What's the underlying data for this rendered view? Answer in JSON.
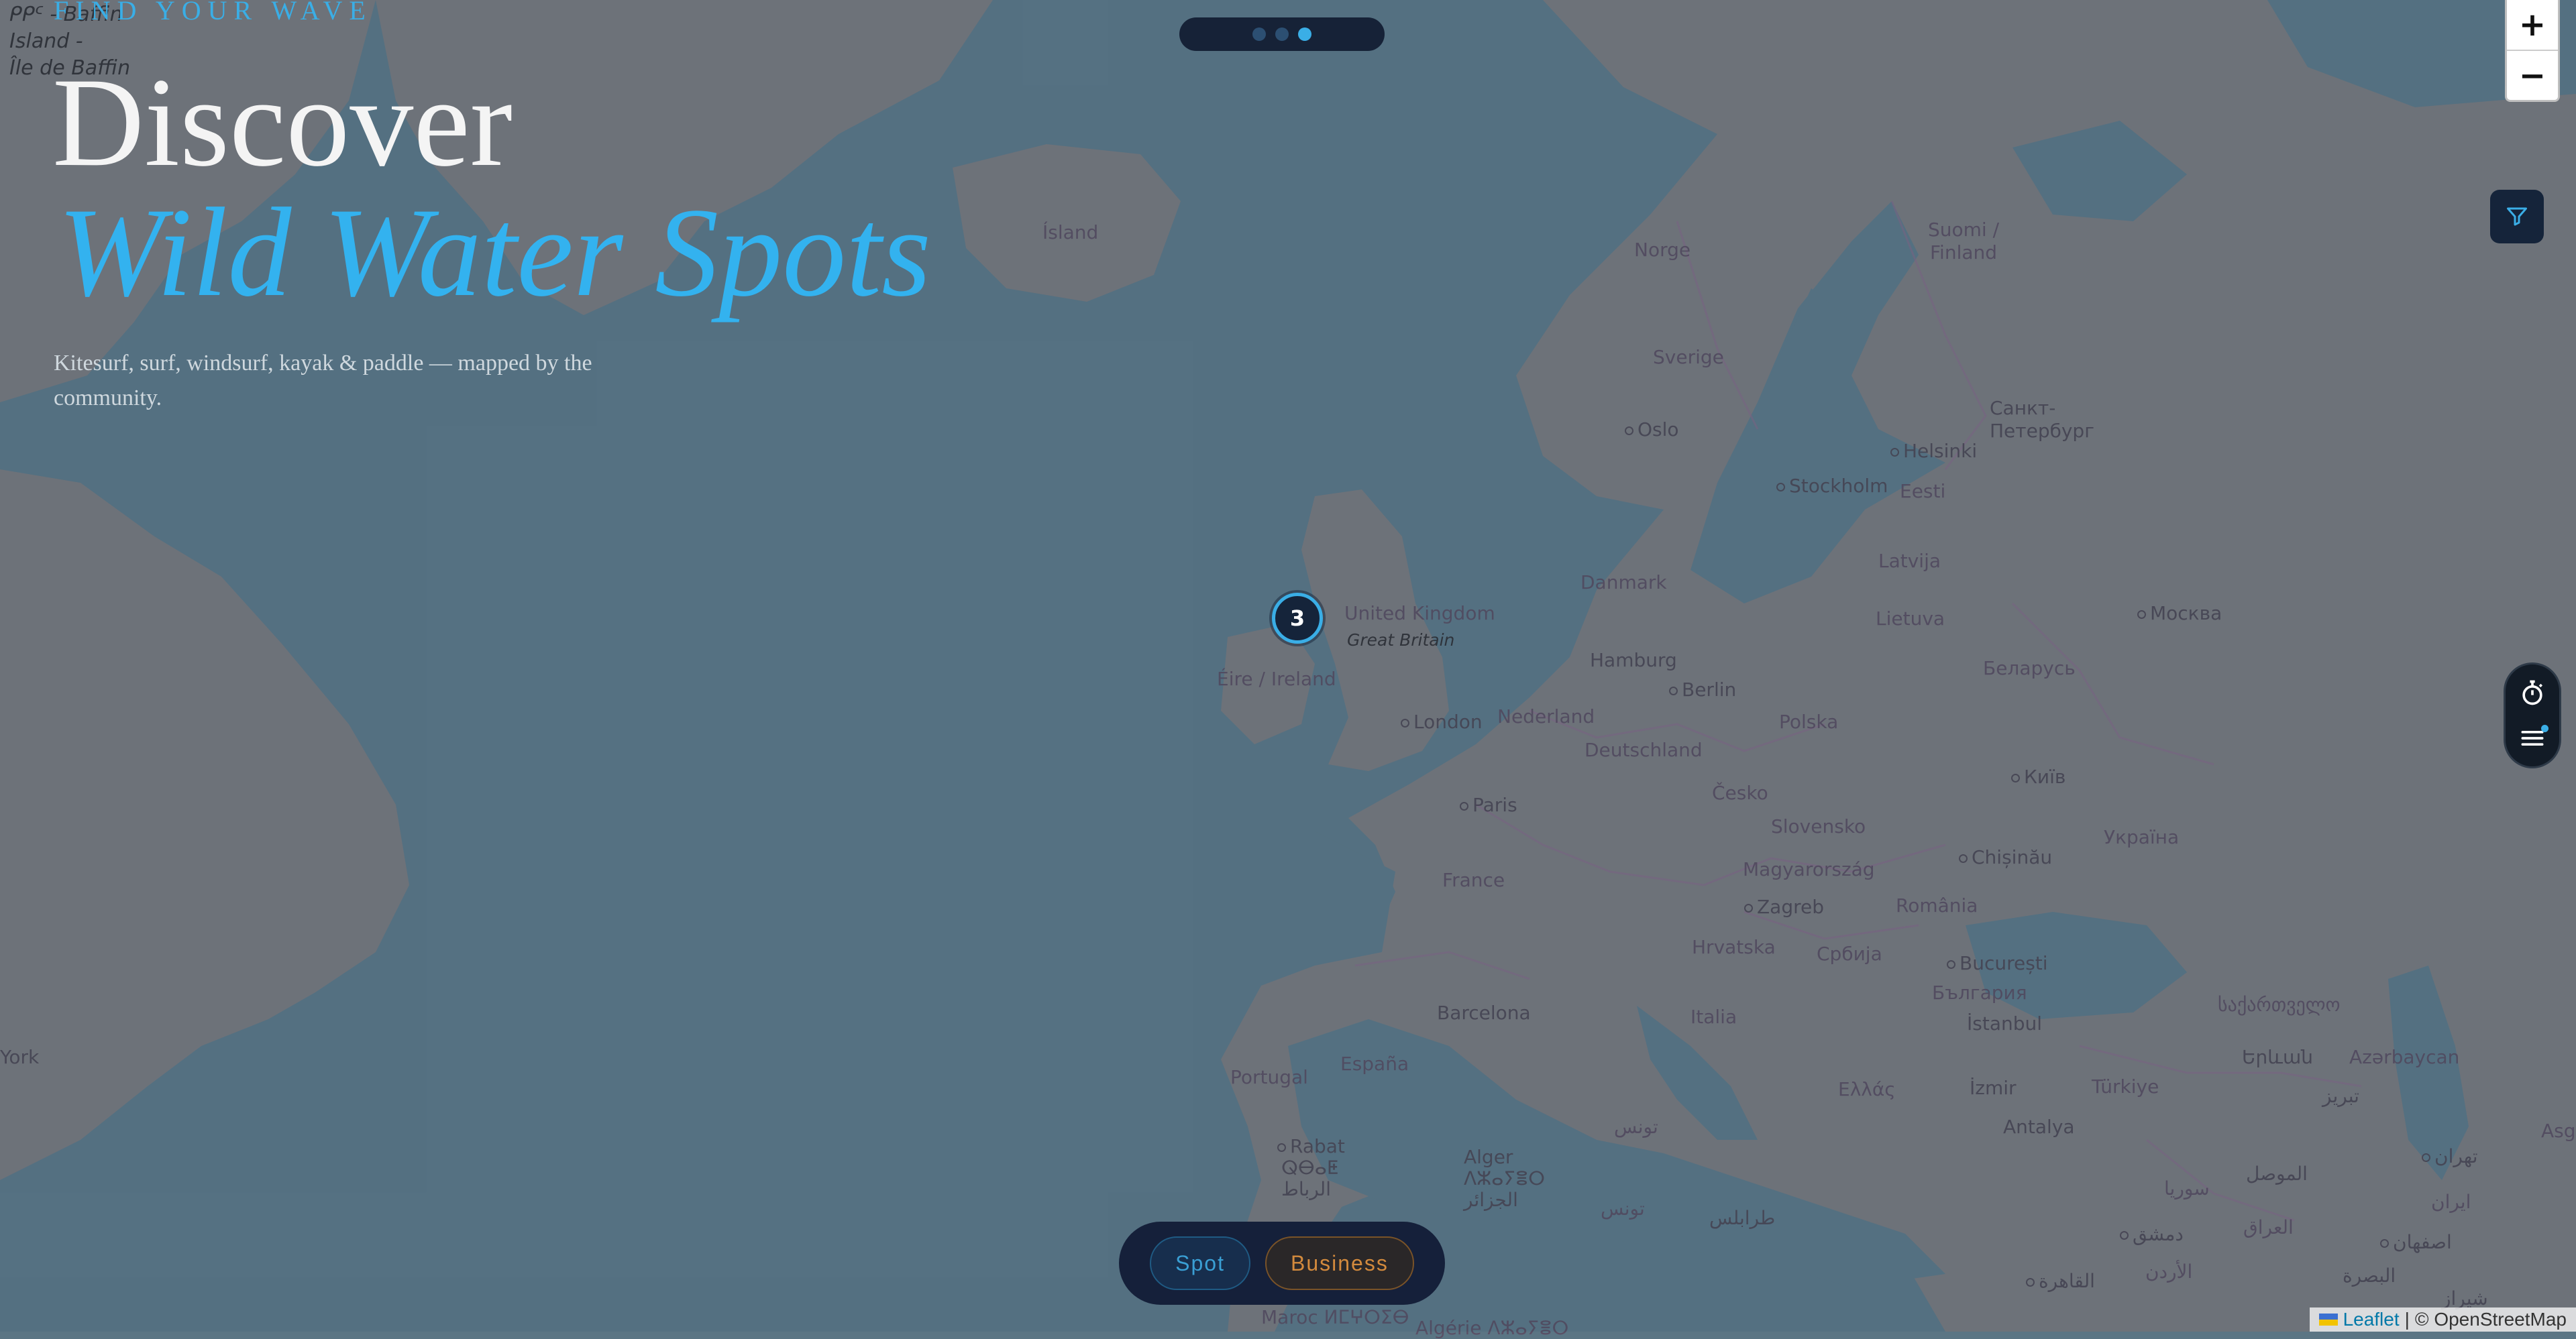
{
  "hero": {
    "eyebrow": "FIND YOUR WAVE",
    "line1": "Discover",
    "line2": "Wild Water Spots",
    "subtitle": "Kitesurf, surf, windsurf, kayak & paddle — mapped by the community."
  },
  "pager": {
    "pages": 3,
    "active_index": 3
  },
  "zoom": {
    "in_label": "+",
    "out_label": "−"
  },
  "cluster": {
    "count": "3"
  },
  "bottom_bar": {
    "spot_label": "Spot",
    "business_label": "Business"
  },
  "attribution": {
    "leaflet": "Leaflet",
    "separator": "|",
    "osm": "© OpenStreetMap"
  },
  "map_labels": {
    "baffin": [
      "ᑭᑭᑦ - Baffin",
      "Island -",
      "Île de Baffin"
    ],
    "island": "Ísland",
    "norge": "Norge",
    "sverige": "Sverige",
    "suomi": [
      "Suomi /",
      "Finland"
    ],
    "spb": [
      "Санкт-",
      "Петербург"
    ],
    "oslo": "Oslo",
    "stockholm": "Stockholm",
    "helsinki": "Helsinki",
    "eesti": "Eesti",
    "latvija": "Latvija",
    "lietuva": "Lietuva",
    "moskva": "Москва",
    "belarus": "Беларусь",
    "danmark": "Danmark",
    "uk": "United Kingdom",
    "great_britain": "Great Britain",
    "eire": "Éire / Ireland",
    "hamburg": "Hamburg",
    "berlin": "Berlin",
    "polska": "Polska",
    "london": "London",
    "nederland": "Nederland",
    "deutschland": "Deutschland",
    "cesko": "Česko",
    "kyiv": "Київ",
    "ukraina": "Україна",
    "paris": "Paris",
    "slovensko": "Slovensko",
    "chisinau": "Chișinău",
    "magyar": "Magyarország",
    "france": "France",
    "zagreb": "Zagreb",
    "romania": "România",
    "hrvatska": "Hrvatska",
    "srbija": "Србија",
    "bucuresti": "București",
    "bulgaria": "България",
    "istanbul": "İstanbul",
    "georgia": "საქართველო",
    "barcelona": "Barcelona",
    "italia": "Italia",
    "portugal": "Portugal",
    "espana": "España",
    "yerevan": "Երևան",
    "azerbaycan": "Azərbaycan",
    "ellas": "Ελλάς",
    "izmir": "İzmir",
    "turkiye": "Türkiye",
    "tabriz": "تبریز",
    "antalya": "Antalya",
    "tunis": "تونس",
    "rabat": "Rabat",
    "rabat_local": [
      "ⵕⴱⴰⵟ",
      "الرباط"
    ],
    "alger": [
      "Alger",
      "ⴷⵣⴰⵢⴻⵔ",
      "الجزائر"
    ],
    "tounes": "تونس",
    "tarabulus": "طرابلس",
    "suriya": "سوريا",
    "mosul": "الموصل",
    "iraq": "العراق",
    "dimashq": "دمشق",
    "alurdun": "الأردن",
    "isfahan": "اصفهان",
    "basra": "البصرة",
    "shiraz": "شیراز",
    "cairo": "القاهرة",
    "tehran": "تهران",
    "iran": "ایران",
    "maroc": "Maroc ⵍⵎⵖⵔⵉⴱ",
    "algerie": "Algérie ⴷⵣⴰⵢⴻⵔ",
    "york": "York",
    "asg": "Asg"
  }
}
